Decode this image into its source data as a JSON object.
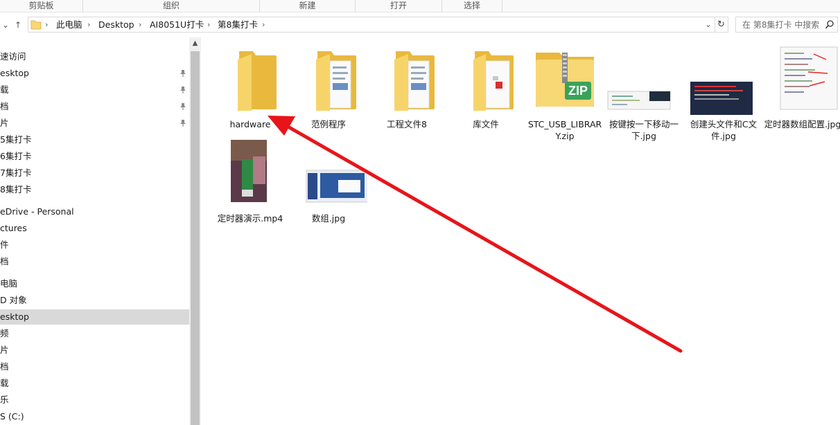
{
  "ribbon": {
    "groups": [
      "剪贴板",
      "组织",
      "新建",
      "打开",
      "选择"
    ]
  },
  "address": {
    "crumbs": [
      "此电脑",
      "Desktop",
      "AI8051U打卡",
      "第8集打卡"
    ],
    "search_placeholder": "在 第8集打卡 中搜索"
  },
  "nav": {
    "items": [
      {
        "label": "速访问",
        "pinned": false
      },
      {
        "label": "esktop",
        "pinned": true
      },
      {
        "label": "载",
        "pinned": true
      },
      {
        "label": "档",
        "pinned": true
      },
      {
        "label": "片",
        "pinned": true
      },
      {
        "label": "5集打卡",
        "pinned": false
      },
      {
        "label": "6集打卡",
        "pinned": false
      },
      {
        "label": "7集打卡",
        "pinned": false
      },
      {
        "label": "8集打卡",
        "pinned": false
      },
      {
        "label": "eDrive - Personal",
        "pinned": false
      },
      {
        "label": "ctures",
        "pinned": false
      },
      {
        "label": "件",
        "pinned": false
      },
      {
        "label": "档",
        "pinned": false
      },
      {
        "label": "电脑",
        "pinned": false
      },
      {
        "label": "D 对象",
        "pinned": false
      },
      {
        "label": "esktop",
        "pinned": false,
        "selected": true
      },
      {
        "label": "频",
        "pinned": false
      },
      {
        "label": "片",
        "pinned": false
      },
      {
        "label": "档",
        "pinned": false
      },
      {
        "label": "载",
        "pinned": false
      },
      {
        "label": "乐",
        "pinned": false
      },
      {
        "label": "S (C:)",
        "pinned": false
      }
    ]
  },
  "files": [
    {
      "name": "hardware",
      "type": "folder-empty"
    },
    {
      "name": "范例程序",
      "type": "folder-docs"
    },
    {
      "name": "工程文件8",
      "type": "folder-docs"
    },
    {
      "name": "库文件",
      "type": "folder-lib"
    },
    {
      "name": "STC_USB_LIBRARY.zip",
      "type": "zip"
    },
    {
      "name": "按键按一下移动一下.jpg",
      "type": "image-code-wide"
    },
    {
      "name": "创建头文件和C文件.jpg",
      "type": "image-dark"
    },
    {
      "name": "定时器数组配置.jpg",
      "type": "image-code-tall"
    },
    {
      "name": "定时器演示.mp4",
      "type": "video"
    },
    {
      "name": "数组.jpg",
      "type": "image-slides"
    }
  ],
  "colors": {
    "folder": "#f8d775",
    "folder_dark": "#e8b93d",
    "zip": "#3aa35a",
    "annotation_arrow": "#e8141a"
  }
}
